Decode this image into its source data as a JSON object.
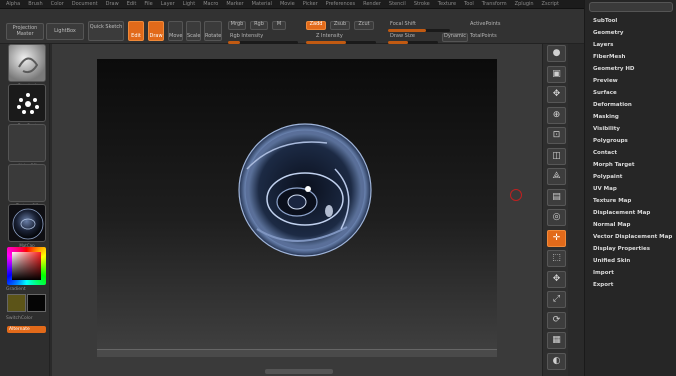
{
  "menubar": {
    "items": [
      "Alpha",
      "Brush",
      "Color",
      "Document",
      "Draw",
      "Edit",
      "File",
      "Layer",
      "Light",
      "Macro",
      "Marker",
      "Material",
      "Movie",
      "Picker",
      "Preferences",
      "Render",
      "Stencil",
      "Stroke",
      "Texture",
      "Tool",
      "Transform",
      "Zplugin",
      "Zscript"
    ]
  },
  "toolbar": {
    "projection_master": "Projection Master",
    "lightbox": "LightBox",
    "quick_sketch": "Quick Sketch",
    "edit": "Edit",
    "draw": "Draw",
    "move": "Move",
    "scale": "Scale",
    "rotate": "Rotate",
    "mrgb": "Mrgb",
    "rgb": "Rgb",
    "m": "M",
    "zadd": "Zadd",
    "zsub": "Zsub",
    "zcut": "Zcut",
    "rgb_intensity": "Rgb Intensity",
    "z_intensity": "Z Intensity",
    "focal_shift": "Focal Shift",
    "draw_size": "Draw Size",
    "dynamic": "Dynamic",
    "active_points": "ActivePoints",
    "total_points": "TotalPoints"
  },
  "leftshelf": {
    "thumb_captions": [
      "Standard",
      "DragRect",
      "Alpha Off",
      "Texture Off",
      "MatCap"
    ],
    "gradient": "Gradient",
    "switch_color": "SwitchColor",
    "alternate": "Alternate"
  },
  "rightshelf": {
    "items": [
      {
        "icon": "sphere",
        "label": "BPR"
      },
      {
        "icon": "spix",
        "label": "SPix"
      },
      {
        "icon": "scroll",
        "label": "Scroll"
      },
      {
        "icon": "zoom",
        "label": "Zoom"
      },
      {
        "icon": "actual",
        "label": "Actual"
      },
      {
        "icon": "aahalf",
        "label": "AAHalf"
      },
      {
        "icon": "persp",
        "label": "Persp"
      },
      {
        "icon": "floor",
        "label": "Floor"
      },
      {
        "icon": "local",
        "label": "Local"
      },
      {
        "icon": "xyz",
        "label": "Xyz"
      },
      {
        "icon": "frame",
        "label": "Frame"
      },
      {
        "icon": "move",
        "label": "Move"
      },
      {
        "icon": "scale",
        "label": "Scale"
      },
      {
        "icon": "rotate",
        "label": "Rotate"
      },
      {
        "icon": "polyf",
        "label": "PolyF"
      },
      {
        "icon": "transp",
        "label": "Transp"
      }
    ]
  },
  "palette": {
    "top_label": "",
    "items": [
      "SubTool",
      "Geometry",
      "Layers",
      "FiberMesh",
      "Geometry HD",
      "Preview",
      "Surface",
      "Deformation",
      "Masking",
      "Visibility",
      "Polygroups",
      "Contact",
      "Morph Target",
      "Polypaint",
      "UV Map",
      "Texture Map",
      "Displacement Map",
      "Normal Map",
      "Vector Displacement Map",
      "Display Properties",
      "Unified Skin",
      "Import",
      "Export"
    ]
  },
  "colors": {
    "accent": "#e26a1a",
    "background": "#2a2a2a",
    "palette_bg": "#262626"
  }
}
